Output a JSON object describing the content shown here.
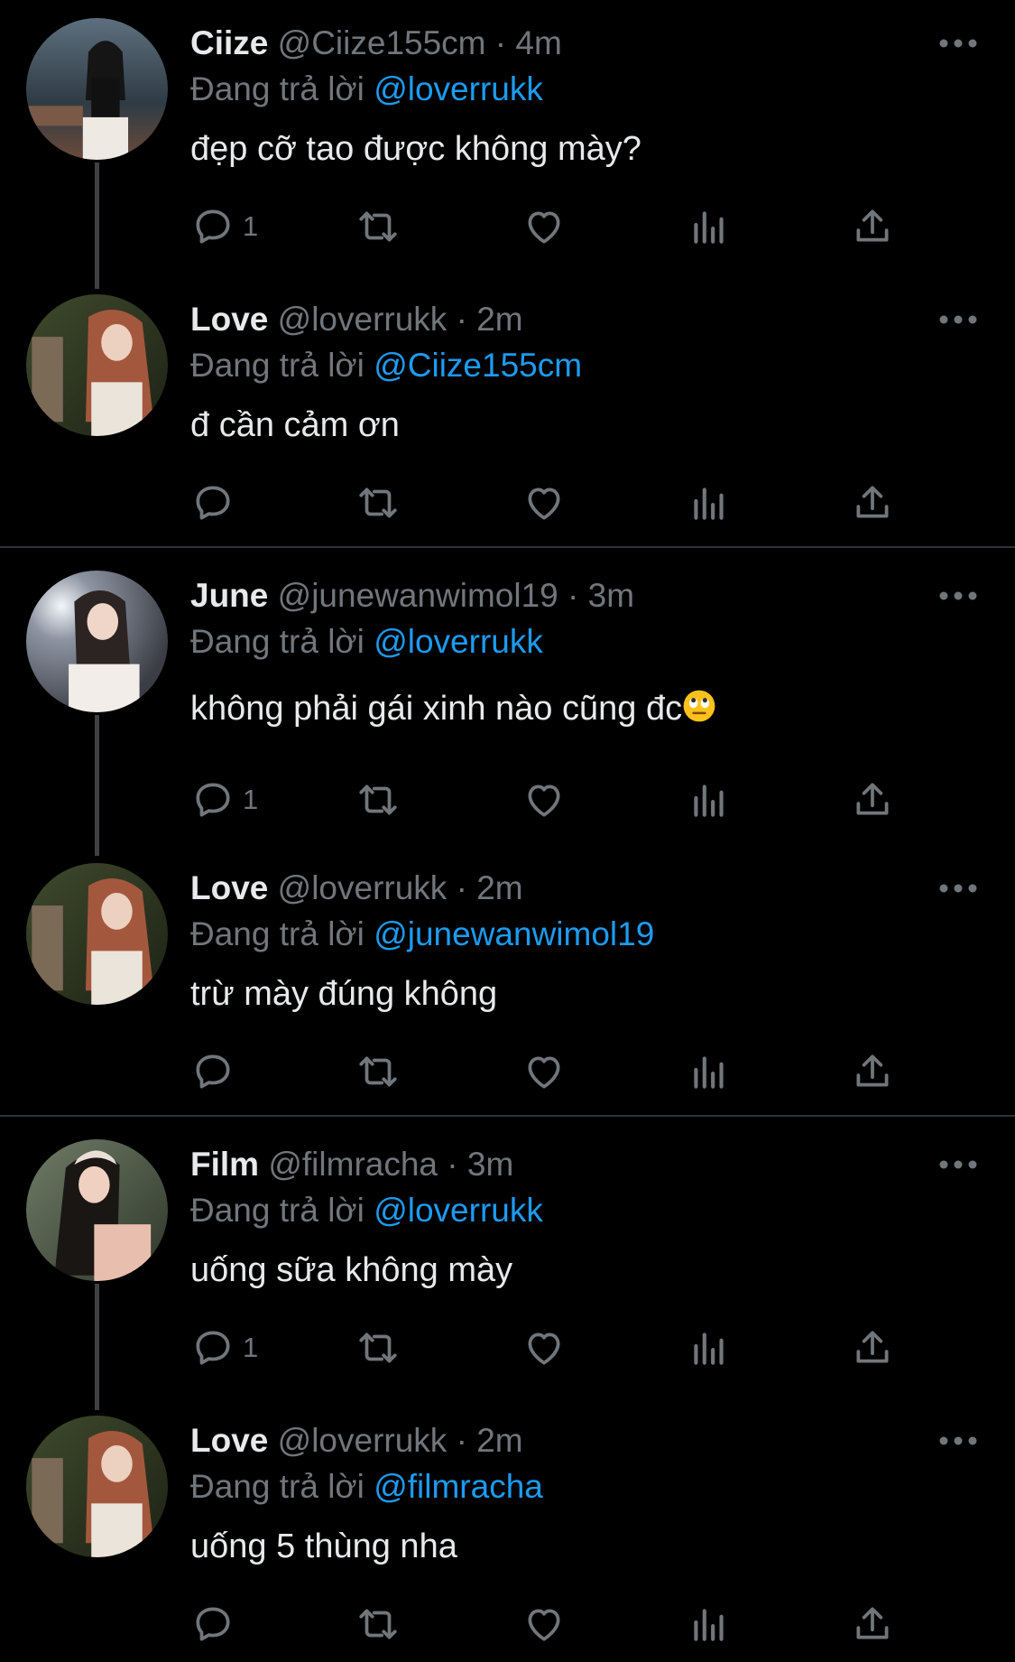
{
  "tweets": [
    {
      "name": "Ciize",
      "handle": "@Ciize155cm",
      "time": "4m",
      "replying_prefix": "Đang trả lời",
      "replying_to": "@loverrukk",
      "text": "đẹp cỡ tao được không mày?",
      "reply_count": "1",
      "avatar_icon": "avatar-photo"
    },
    {
      "name": "Love",
      "handle": "@loverrukk",
      "time": "2m",
      "replying_prefix": "Đang trả lời",
      "replying_to": "@Ciize155cm",
      "text": "đ cần cảm ơn",
      "reply_count": "",
      "avatar_icon": "avatar-photo"
    },
    {
      "name": "June",
      "handle": "@junewanwimol19",
      "time": "3m",
      "replying_prefix": "Đang trả lời",
      "replying_to": "@loverrukk",
      "text": "không phải gái xinh nào cũng đc",
      "text_emoji": "rolling-eyes-emoji",
      "reply_count": "1",
      "avatar_icon": "avatar-photo"
    },
    {
      "name": "Love",
      "handle": "@loverrukk",
      "time": "2m",
      "replying_prefix": "Đang trả lời",
      "replying_to": "@junewanwimol19",
      "text": "trừ mày đúng không",
      "reply_count": "",
      "avatar_icon": "avatar-photo"
    },
    {
      "name": "Film",
      "handle": "@filmracha",
      "time": "3m",
      "replying_prefix": "Đang trả lời",
      "replying_to": "@loverrukk",
      "text": "uống sữa không mày",
      "reply_count": "1",
      "avatar_icon": "avatar-photo"
    },
    {
      "name": "Love",
      "handle": "@loverrukk",
      "time": "2m",
      "replying_prefix": "Đang trả lời",
      "replying_to": "@filmracha",
      "text": "uống 5 thùng nha",
      "reply_count": "",
      "avatar_icon": "avatar-photo"
    }
  ],
  "separator": "·",
  "colors": {
    "background": "#000000",
    "text": "#e7e9ea",
    "muted": "#71767b",
    "accent": "#1d9bf0",
    "divider": "#2f3336"
  },
  "icons": [
    "reply-icon",
    "retweet-icon",
    "like-icon",
    "views-icon",
    "share-icon",
    "more-icon"
  ]
}
